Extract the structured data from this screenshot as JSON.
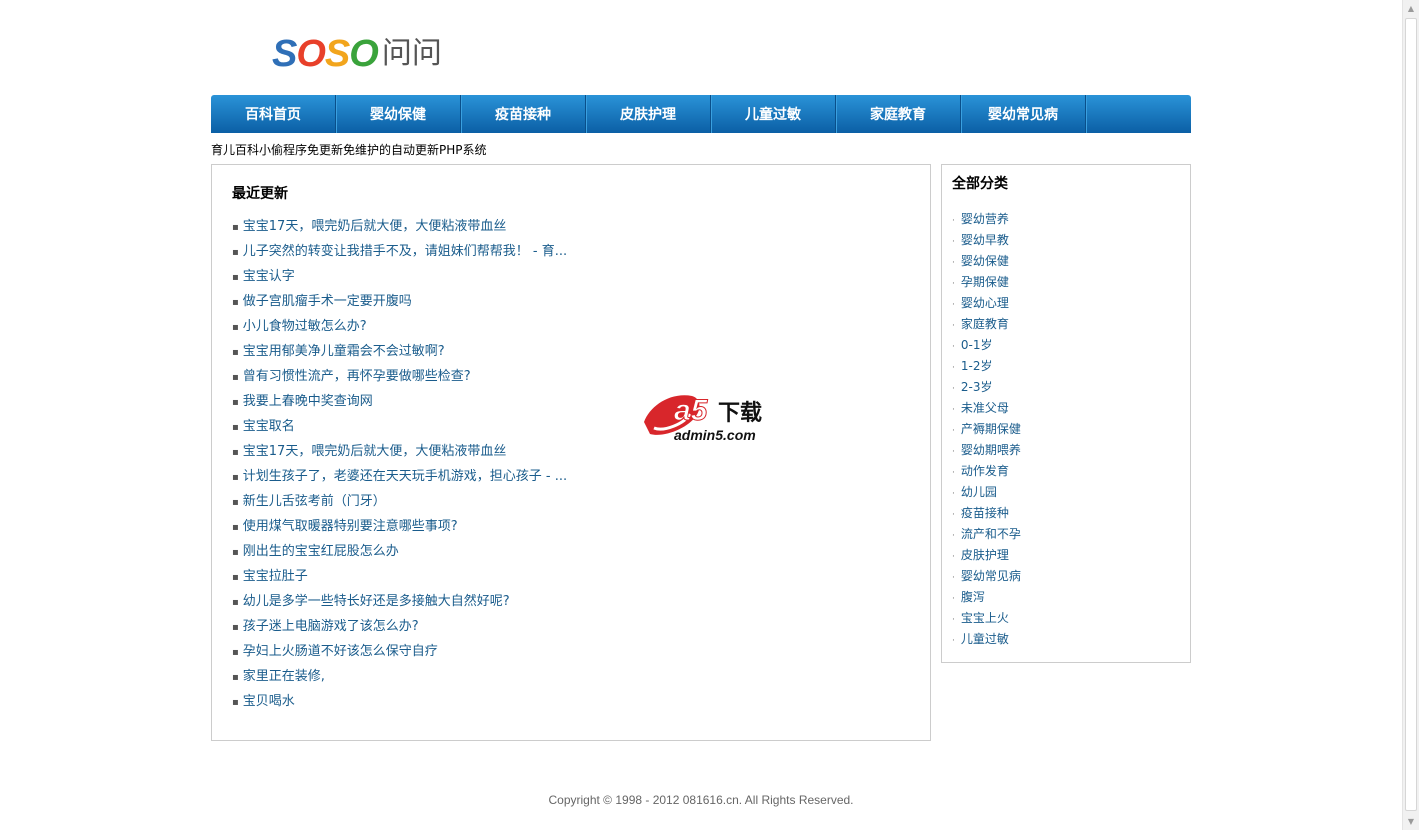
{
  "logo": {
    "soso": [
      "S",
      "O",
      "S",
      "O"
    ],
    "wenwen": "问问"
  },
  "nav": {
    "items": [
      "百科首页",
      "婴幼保健",
      "疫苗接种",
      "皮肤护理",
      "儿童过敏",
      "家庭教育",
      "婴幼常见病"
    ]
  },
  "tagline": "育儿百科小偷程序免更新免维护的自动更新PHP系统",
  "recent": {
    "title": "最近更新",
    "bullet": "▪",
    "items": [
      "宝宝17天，喂完奶后就大便，大便粘液带血丝",
      "儿子突然的转变让我措手不及，请姐妹们帮帮我！ - 育...",
      "宝宝认字",
      "做子宫肌瘤手术一定要开腹吗",
      "小儿食物过敏怎么办?",
      "宝宝用郁美净儿童霜会不会过敏啊?",
      "曾有习惯性流产，再怀孕要做哪些检查?",
      "我要上春晚中奖查询网",
      "宝宝取名",
      "宝宝17天，喂完奶后就大便，大便粘液带血丝",
      "计划生孩子了，老婆还在天天玩手机游戏，担心孩子 - ...",
      "新生儿舌弦考前（门牙）",
      "使用煤气取暖器特别要注意哪些事项?",
      "刚出生的宝宝红屁股怎么办",
      "宝宝拉肚子",
      "幼儿是多学一些特长好还是多接触大自然好呢?",
      "孩子迷上电脑游戏了该怎么办?",
      "孕妇上火肠道不好该怎么保守自疗",
      "家里正在装修,",
      "宝贝喝水"
    ]
  },
  "categories": {
    "title": "全部分类",
    "bullet": "·",
    "items": [
      "婴幼营养",
      "婴幼早教",
      "婴幼保健",
      "孕期保健",
      "婴幼心理",
      "家庭教育",
      "0-1岁",
      "1-2岁",
      "2-3岁",
      "未准父母",
      "产褥期保健",
      "婴幼期喂养",
      "动作发育",
      "幼儿园",
      "疫苗接种",
      "流产和不孕",
      "皮肤护理",
      "婴幼常见病",
      "腹泻",
      "宝宝上火",
      "儿童过敏"
    ]
  },
  "watermark": {
    "brand": "a5",
    "label": "下载",
    "domain": "admin5.com"
  },
  "footer": "Copyright © 1998 - 2012 081616.cn. All Rights Reserved.",
  "colors": {
    "nav_top": "#2a93d8",
    "nav_bottom": "#0b5fa5",
    "link": "#1a5c8c",
    "watermark_red": "#d8262b"
  },
  "scrollbar": {
    "up_icon": "up-arrow-icon",
    "down_icon": "down-arrow-icon"
  }
}
